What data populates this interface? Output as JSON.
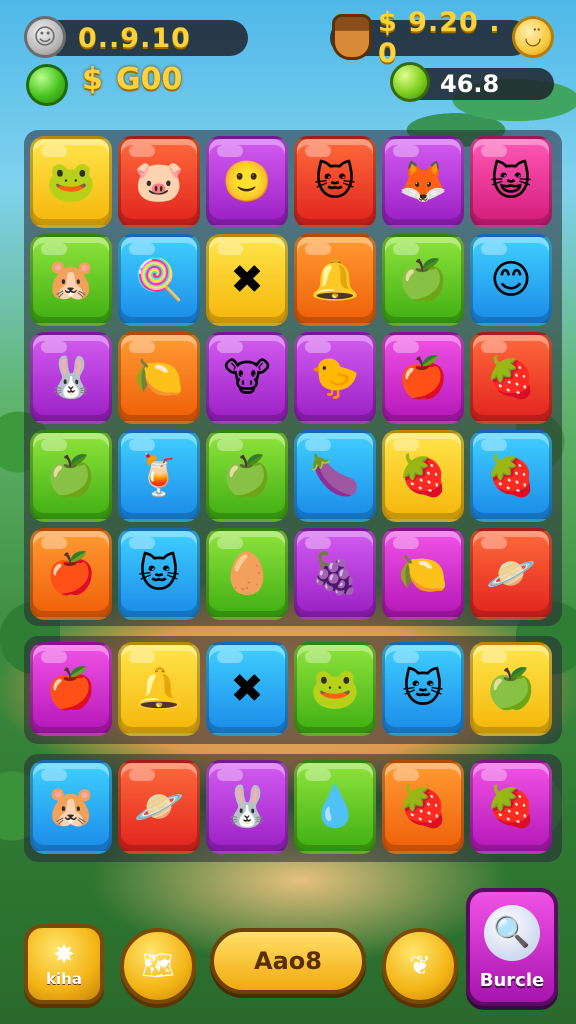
{
  "hud": {
    "left_counter": "0..9.10",
    "right_counter": "$ 9.20 . 0",
    "currency_symbol": "$",
    "currency_value": "G00",
    "right_stat": "46.8",
    "icons": {
      "portrait": "coin-portrait-icon",
      "acorn": "acorn-icon",
      "smiley": "smiley-icon",
      "green_orb": "green-orb-icon",
      "green_leaf": "green-leaf-icon"
    }
  },
  "board": {
    "rows": [
      [
        {
          "color": "yellow",
          "glyph": "🐸"
        },
        {
          "color": "red",
          "glyph": "🐷"
        },
        {
          "color": "purple",
          "glyph": "🙂"
        },
        {
          "color": "red",
          "glyph": "🐱"
        },
        {
          "color": "purple",
          "glyph": "🦊"
        },
        {
          "color": "pink",
          "glyph": "😺"
        }
      ],
      [
        {
          "color": "green",
          "glyph": "🐹"
        },
        {
          "color": "blue",
          "glyph": "🍭"
        },
        {
          "color": "yellow",
          "glyph": "✖"
        },
        {
          "color": "orange",
          "glyph": "🔔"
        },
        {
          "color": "green",
          "glyph": "🍏"
        },
        {
          "color": "blue",
          "glyph": "😊"
        }
      ],
      [
        {
          "color": "purple",
          "glyph": "🐰"
        },
        {
          "color": "orange",
          "glyph": "🍋"
        },
        {
          "color": "purple",
          "glyph": "🐮"
        },
        {
          "color": "purple",
          "glyph": "🐤"
        },
        {
          "color": "magenta",
          "glyph": "🍎"
        },
        {
          "color": "red",
          "glyph": "🍓"
        }
      ],
      [
        {
          "color": "green",
          "glyph": "🍏"
        },
        {
          "color": "blue",
          "glyph": "🍹"
        },
        {
          "color": "green",
          "glyph": "🍏"
        },
        {
          "color": "blue",
          "glyph": "🍆"
        },
        {
          "color": "yellow",
          "glyph": "🍓"
        },
        {
          "color": "blue",
          "glyph": "🍓"
        }
      ],
      [
        {
          "color": "orange",
          "glyph": "🍎"
        },
        {
          "color": "blue",
          "glyph": "🐱"
        },
        {
          "color": "green",
          "glyph": "🥚"
        },
        {
          "color": "purple",
          "glyph": "🍇"
        },
        {
          "color": "magenta",
          "glyph": "🍋"
        },
        {
          "color": "red",
          "glyph": "🪐"
        }
      ]
    ],
    "row6": [
      {
        "color": "magenta",
        "glyph": "🍎"
      },
      {
        "color": "yellow",
        "glyph": "🔔"
      },
      {
        "color": "blue",
        "glyph": "✖"
      },
      {
        "color": "green",
        "glyph": "🐸"
      },
      {
        "color": "blue",
        "glyph": "🐱"
      },
      {
        "color": "yellow",
        "glyph": "🍏"
      }
    ],
    "row7": [
      {
        "color": "blue",
        "glyph": "🐹"
      },
      {
        "color": "red",
        "glyph": "🪐"
      },
      {
        "color": "purple",
        "glyph": "🐰"
      },
      {
        "color": "green",
        "glyph": "💧"
      },
      {
        "color": "orange",
        "glyph": "🍓"
      },
      {
        "color": "magenta",
        "glyph": "🍓"
      }
    ]
  },
  "bottom_bar": {
    "kiha_label": "kiha",
    "kiha_icon": "✸",
    "map_icon": "🗺",
    "abod_label": "Aao8",
    "hint_icon": "❦",
    "burcle_label": "Burcle",
    "burcle_icon": "🔍"
  }
}
